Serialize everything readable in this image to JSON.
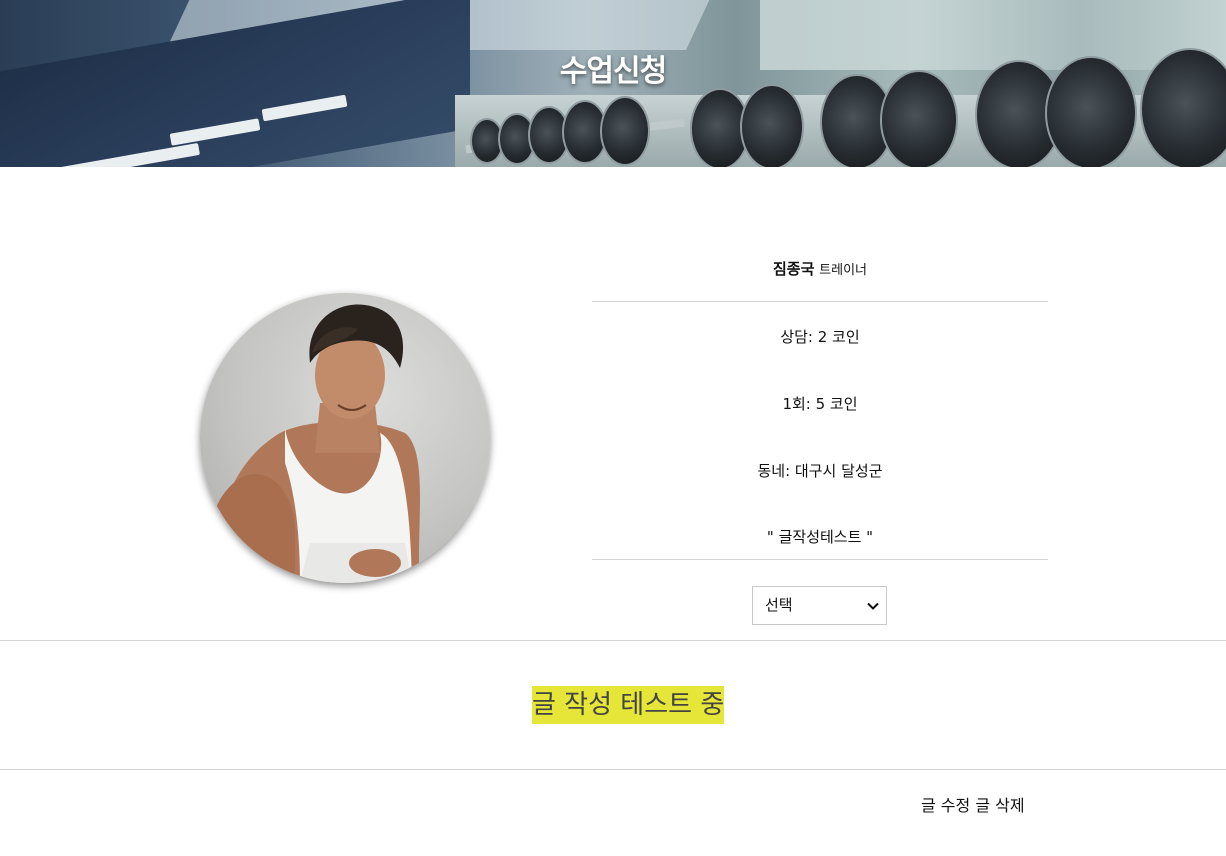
{
  "banner": {
    "title": "수업신청"
  },
  "trainer": {
    "name": "짐종국",
    "role": "트레이너",
    "consult": "상담: 2 코인",
    "session": "1회: 5 코인",
    "area": "동네: 대구시 달성군",
    "quote": "\" 글작성테스트 \""
  },
  "select": {
    "value": "선택"
  },
  "post": {
    "title": "글 작성 테스트 중"
  },
  "actions": {
    "edit": "글 수정",
    "delete": "글 삭제"
  }
}
